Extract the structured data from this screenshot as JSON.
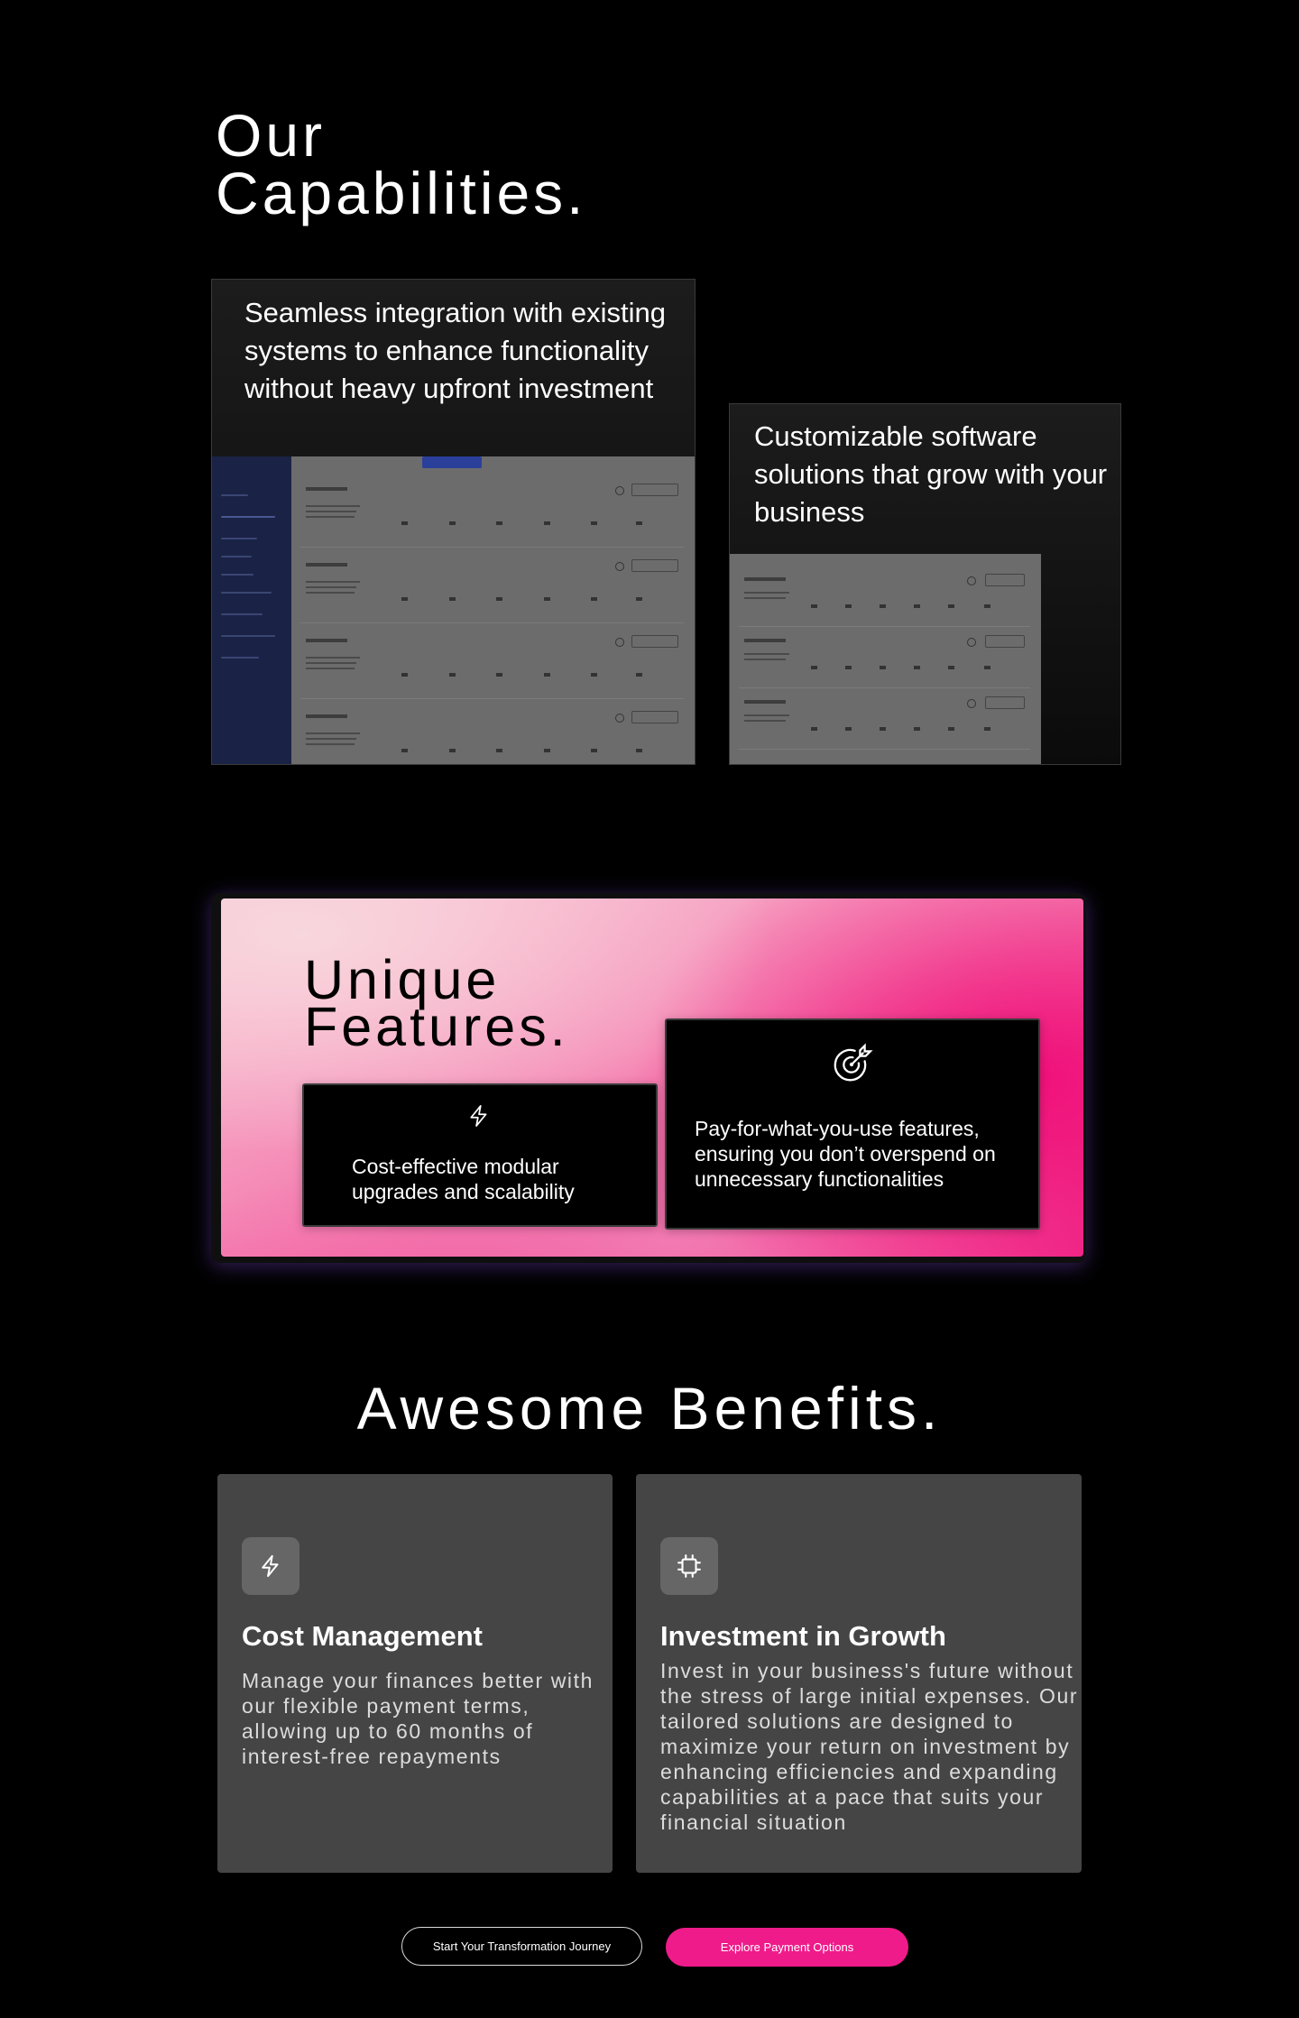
{
  "capabilities": {
    "title_line1": "Our",
    "title_line2": "Capabilities.",
    "card1_text": "Seamless integration with existing systems to enhance functionality without heavy upfront investment",
    "card2_text": "Customizable software solutions that grow with your business"
  },
  "unique_features": {
    "title_line1": "Unique",
    "title_line2": "Features.",
    "card1_icon": "lightning-icon",
    "card1_text": "Cost-effective modular upgrades and scalability",
    "card2_icon": "target-arrow-icon",
    "card2_text": "Pay-for-what-you-use features, ensuring you don’t overspend on unnecessary functionalities",
    "colors": {
      "panel_light": "#f8c5d4",
      "panel_hot": "#ef2184"
    }
  },
  "benefits": {
    "title": "Awesome Benefits.",
    "card1": {
      "icon": "lightning-icon",
      "heading": "Cost Management",
      "body": "Manage your finances better with our flexible payment terms, allowing up to 60 months of interest-free repayments"
    },
    "card2": {
      "icon": "chip-icon",
      "heading": "Investment in Growth",
      "body": "Invest in your business's future without the stress of large initial expenses. Our tailored solutions are designed to maximize your return on investment by enhancing efficiencies and expanding capabilities at a pace that suits your financial situation"
    }
  },
  "cta": {
    "secondary_label": "Start Your Transformation Journey",
    "primary_label": "Explore Payment Options",
    "primary_color": "#ef1b8a"
  }
}
